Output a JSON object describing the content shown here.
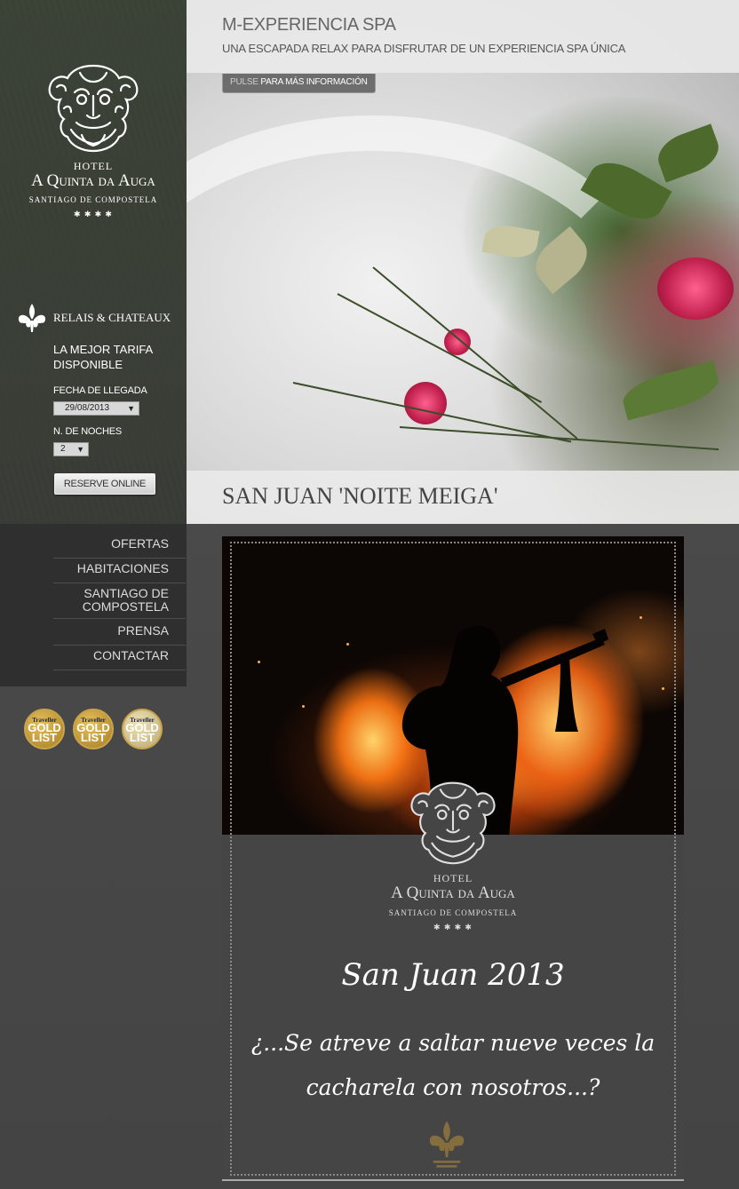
{
  "brand": {
    "hotel_label": "HOTEL",
    "name": "A Quinta da Auga",
    "city": "SANTIAGO DE COMPOSTELA",
    "stars": "✱ ✱ ✱ ✱"
  },
  "relais": {
    "label": "RELAIS & CHATEAUX"
  },
  "booking": {
    "heading": "LA MEJOR TARIFA DISPONIBLE",
    "arrival_label": "FECHA DE LLEGADA",
    "arrival_value": "29/08/2013",
    "nights_label": "N. DE NOCHES",
    "nights_value": "2",
    "reserve_label": "RESERVE ONLINE"
  },
  "banner": {
    "title": "M-EXPERIENCIA SPA",
    "subtitle": "UNA ESCAPADA RELAX PARA DISFRUTAR DE UN EXPERIENCIA SPA ÚNICA",
    "info_pre": "PULSE",
    "info_post": "PARA MÁS INFORMACIÓN"
  },
  "caption": "SAN JUAN 'NOITE MEIGA'",
  "menu": [
    "OFERTAS",
    "HABITACIONES",
    "SANTIAGO DE COMPOSTELA",
    "PRENSA",
    "CONTACTAR"
  ],
  "badges": [
    {
      "top": "Traveller",
      "main": "GOLD LIST"
    },
    {
      "top": "Traveller",
      "main": "GOLD LIST"
    },
    {
      "top": "Traveller",
      "main": "GOLD LIST"
    }
  ],
  "poster": {
    "hotel_label": "HOTEL",
    "name": "A Quinta da Auga",
    "city": "SANTIAGO DE COMPOSTELA",
    "stars": "✱ ✱ ✱ ✱",
    "headline": "San Juan 2013",
    "question_line1": "¿...Se atreve a saltar nueve veces la",
    "question_line2": "cacharela con nosotros...?"
  },
  "colors": {
    "accent_gold": "#c9a24a",
    "panel": "#2f2f2f",
    "banner": "#ebebeb"
  },
  "icons": [
    "green-man-logo-icon",
    "fleur-de-lis-icon",
    "dropdown-arrow-icon"
  ]
}
